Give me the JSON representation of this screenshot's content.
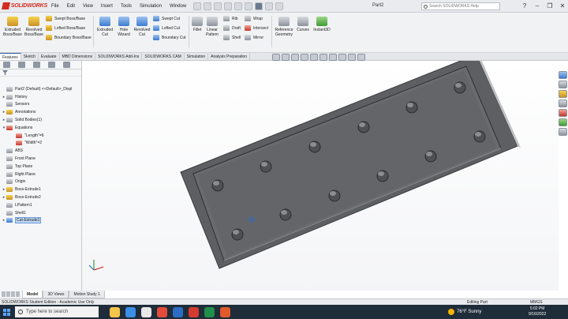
{
  "app": {
    "brand": "SOLIDWORKS",
    "document_title": "Part2",
    "menu": [
      "File",
      "Edit",
      "View",
      "Insert",
      "Tools",
      "Simulation",
      "Window"
    ],
    "search_placeholder": "Search SOLIDWORKS Help",
    "window_controls": [
      "?",
      "–",
      "❐",
      "✕"
    ]
  },
  "ribbon": {
    "large": [
      {
        "name": "extruded-boss-button",
        "label": "Extruded\nBoss/Base",
        "color": "yel"
      },
      {
        "name": "revolved-boss-button",
        "label": "Revolved\nBoss/Base",
        "color": "yel"
      },
      {
        "name": "extruded-cut-button",
        "label": "Extruded\nCut",
        "color": "blu"
      },
      {
        "name": "hole-wizard-button",
        "label": "Hole\nWizard",
        "color": "blu"
      },
      {
        "name": "revolved-cut-button",
        "label": "Revolved\nCut",
        "color": "blu"
      },
      {
        "name": "fillet-button",
        "label": "Fillet",
        "color": "gry"
      },
      {
        "name": "linear-pattern-button",
        "label": "Linear\nPattern",
        "color": "gry"
      },
      {
        "name": "reference-geometry-button",
        "label": "Reference\nGeometry",
        "color": "gry"
      },
      {
        "name": "curves-button",
        "label": "Curves",
        "color": "gry"
      },
      {
        "name": "instant3d-button",
        "label": "Instant3D",
        "color": "grn"
      }
    ],
    "small": [
      {
        "name": "swept-boss-button",
        "label": "Swept Boss/Base",
        "color": "yel"
      },
      {
        "name": "lofted-boss-button",
        "label": "Lofted Boss/Base",
        "color": "yel"
      },
      {
        "name": "boundary-boss-button",
        "label": "Boundary Boss/Base",
        "color": "yel"
      },
      {
        "name": "swept-cut-button",
        "label": "Swept Cut",
        "color": "blu"
      },
      {
        "name": "lofted-cut-button",
        "label": "Lofted Cut",
        "color": "blu"
      },
      {
        "name": "boundary-cut-button",
        "label": "Boundary Cut",
        "color": "blu"
      },
      {
        "name": "rib-button",
        "label": "Rib",
        "color": "gry"
      },
      {
        "name": "draft-button",
        "label": "Draft",
        "color": "gry"
      },
      {
        "name": "shell-button",
        "label": "Shell",
        "color": "gry"
      },
      {
        "name": "wrap-button",
        "label": "Wrap",
        "color": "gry"
      },
      {
        "name": "intersect-button",
        "label": "Intersect",
        "color": "red"
      },
      {
        "name": "mirror-button",
        "label": "Mirror",
        "color": "gry"
      }
    ]
  },
  "command_tabs": [
    "Features",
    "Sketch",
    "Evaluate",
    "MBD Dimensions",
    "SOLIDWORKS Add-Ins",
    "SOLIDWORKS CAM",
    "Simulation",
    "Analysis Preparation"
  ],
  "tree": [
    {
      "label": "Part2 (Default) <<Default>_Displ",
      "arrow": "",
      "color": "gry"
    },
    {
      "label": "History",
      "arrow": "▸",
      "color": "gry"
    },
    {
      "label": "Sensors",
      "arrow": "",
      "color": "gry"
    },
    {
      "label": "Annotations",
      "arrow": "▸",
      "color": "yel"
    },
    {
      "label": "Solid Bodies(1)",
      "arrow": "▸",
      "color": "gry"
    },
    {
      "label": "Equations",
      "arrow": "▾",
      "color": "red"
    },
    {
      "label": "\"Length\"=6",
      "arrow": "",
      "color": "red"
    },
    {
      "label": "\"Width\"=2",
      "arrow": "",
      "color": "red"
    },
    {
      "label": "ABS",
      "arrow": "",
      "color": "gry"
    },
    {
      "label": "Front Plane",
      "arrow": "",
      "color": "gry"
    },
    {
      "label": "Top Plane",
      "arrow": "",
      "color": "gry"
    },
    {
      "label": "Right Plane",
      "arrow": "",
      "color": "gry"
    },
    {
      "label": "Origin",
      "arrow": "",
      "color": "gry"
    },
    {
      "label": "Boss-Extrude1",
      "arrow": "▸",
      "color": "yel"
    },
    {
      "label": "Boss-Extrude2",
      "arrow": "▸",
      "color": "yel"
    },
    {
      "label": "LPattern1",
      "arrow": "",
      "color": "gry"
    },
    {
      "label": "Shell1",
      "arrow": "",
      "color": "gry"
    },
    {
      "label": "Cut-Extrude1",
      "arrow": "▸",
      "color": "blu",
      "selected": true
    }
  ],
  "model_tabs": [
    "Model",
    "3D Views",
    "Motion Study 1"
  ],
  "status": {
    "left": "SOLIDWORKS Student Edition - Academic Use Only",
    "mode": "Editing Part",
    "units": "MMGS"
  },
  "taskbar": {
    "search_placeholder": "Type here to search",
    "weather": "76°F  Sunny",
    "time": "5:02 PM",
    "date": "9/16/2022"
  }
}
